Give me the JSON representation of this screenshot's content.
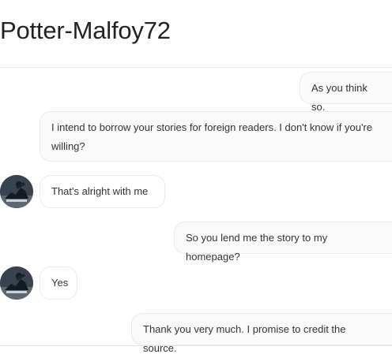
{
  "header": {
    "title": "Potter-Malfoy72"
  },
  "messages": [
    {
      "sender": "me",
      "text": "As you think so."
    },
    {
      "sender": "me",
      "text": "I intend to borrow your stories for foreign readers. I don't know if you're willing?"
    },
    {
      "sender": "author",
      "text": "That's alright with me"
    },
    {
      "sender": "me",
      "text": "So you lend me the story to my homepage?"
    },
    {
      "sender": "author",
      "text": "Yes"
    },
    {
      "sender": "me",
      "text": "Thank you very much. I promise to credit the source."
    }
  ],
  "avatar_icon": "author-avatar-icon"
}
